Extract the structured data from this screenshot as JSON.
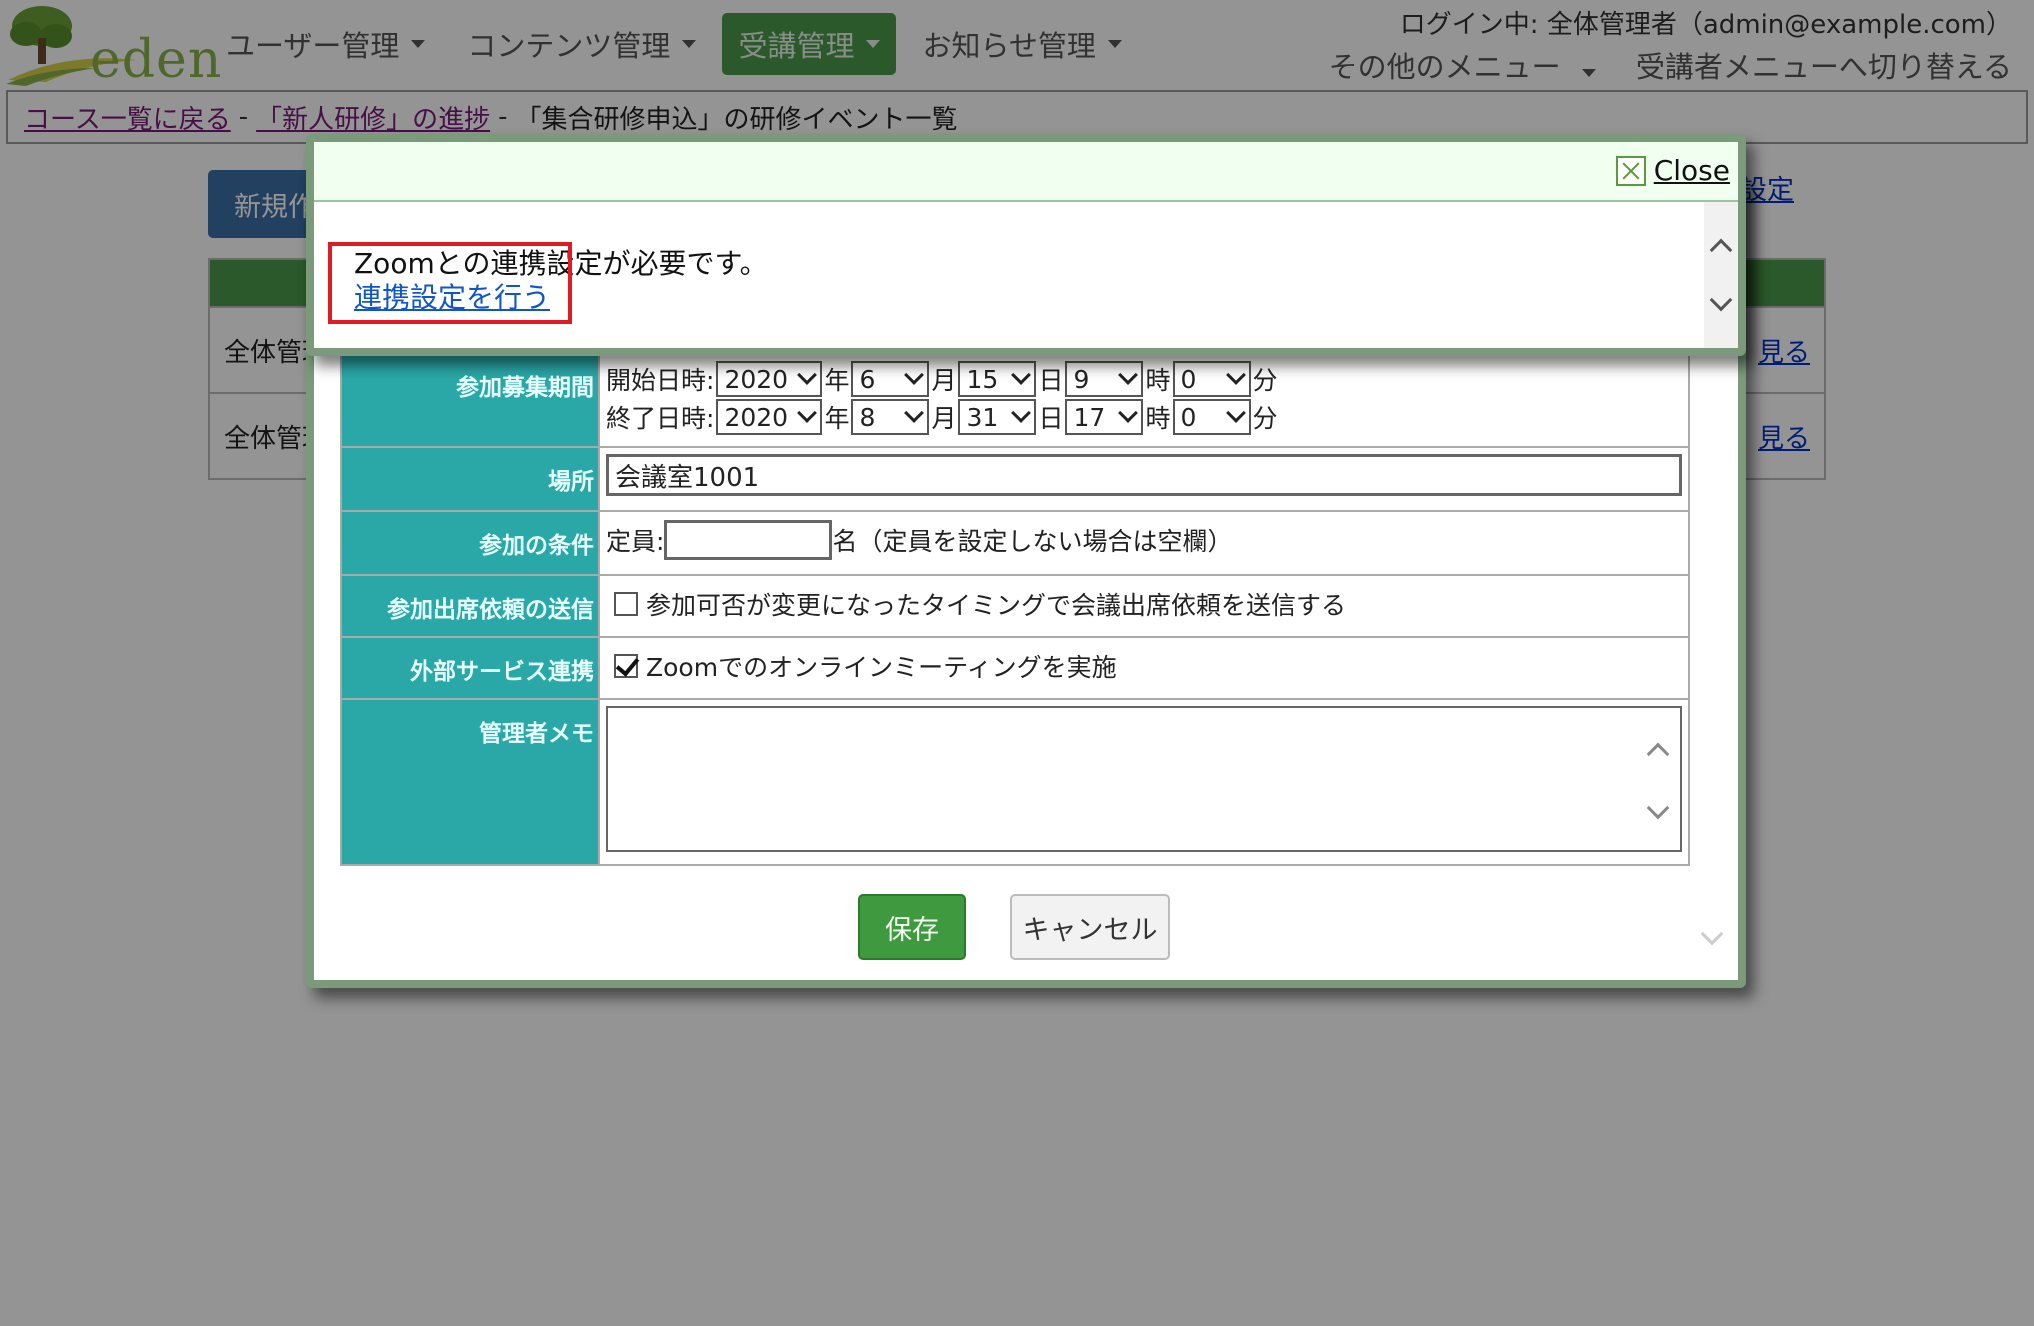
{
  "header": {
    "logo_text": "eden",
    "nav": [
      {
        "label": "ユーザー管理"
      },
      {
        "label": "コンテンツ管理"
      },
      {
        "label": "受講管理"
      },
      {
        "label": "お知らせ管理"
      }
    ],
    "login_info": "ログイン中: 全体管理者（admin@example.com）",
    "other_menu": "その他のメニュー",
    "switch_menu": "受講者メニューへ切り替える"
  },
  "breadcrumb": {
    "back_to_courses": "コース一覧に戻る",
    "separator": "-",
    "progress": "「新人研修」の進捗",
    "current": "「集合研修申込」の研修イベント一覧"
  },
  "page": {
    "new_button": "新規作成",
    "settings_link": "設定",
    "rows": [
      {
        "owner": "全体管理者",
        "view": "見る"
      },
      {
        "owner": "全体管理者",
        "view": "見る"
      }
    ]
  },
  "form": {
    "period": {
      "label": "参加募集期間",
      "start_label": "開始日時:",
      "end_label": "終了日時:",
      "start": {
        "year": "2020",
        "month": "6",
        "day": "15",
        "hour": "9",
        "minute": "0"
      },
      "end": {
        "year": "2020",
        "month": "8",
        "day": "31",
        "hour": "17",
        "minute": "0"
      },
      "unit_year": "年",
      "unit_month": "月",
      "unit_day": "日",
      "unit_hour": "時",
      "unit_minute": "分"
    },
    "place": {
      "label": "場所",
      "value": "会議室1001"
    },
    "condition": {
      "label": "参加の条件",
      "capacity_label": "定員:",
      "capacity_value": "",
      "capacity_note": "名（定員を設定しない場合は空欄）"
    },
    "attendance": {
      "label": "参加出席依頼の送信",
      "checkbox_label": "参加可否が変更になったタイミングで会議出席依頼を送信する",
      "checked": false
    },
    "external": {
      "label": "外部サービス連携",
      "checkbox_label": "Zoomでのオンラインミーティングを実施",
      "checked": true
    },
    "memo": {
      "label": "管理者メモ",
      "value": ""
    },
    "save_button": "保存",
    "cancel_button": "キャンセル"
  },
  "alert": {
    "close_label": "Close",
    "message": "Zoomとの連携設定が必要です。",
    "link": "連携設定を行う"
  },
  "colors": {
    "accent_green": "#4a9a4a",
    "teal_label": "#2aa8a8",
    "highlight_red": "#e01b24",
    "link_blue": "#1155cc"
  }
}
